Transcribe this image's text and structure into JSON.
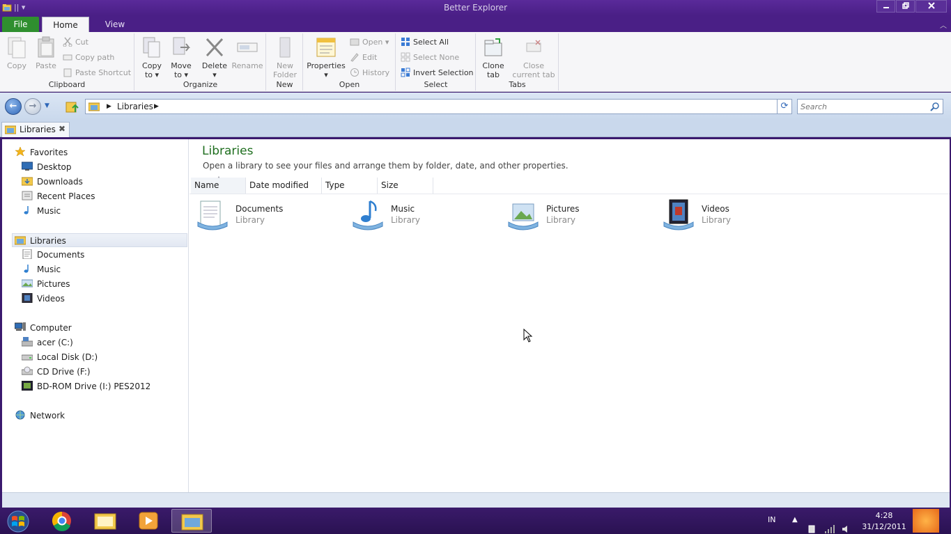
{
  "window": {
    "title": "Better Explorer"
  },
  "ribbon_tabs": {
    "file": "File",
    "home": "Home",
    "view": "View"
  },
  "ribbon": {
    "clipboard": {
      "label": "Clipboard",
      "copy": "Copy",
      "paste": "Paste",
      "cut": "Cut",
      "copy_path": "Copy path",
      "paste_shortcut": "Paste Shortcut"
    },
    "organize": {
      "label": "Organize",
      "copy_to_1": "Copy",
      "copy_to_2": "to ▾",
      "move_to_1": "Move",
      "move_to_2": "to ▾",
      "delete_1": "Delete",
      "delete_2": "▾",
      "rename": "Rename"
    },
    "new": {
      "label": "New",
      "new_folder_1": "New",
      "new_folder_2": "Folder"
    },
    "open": {
      "label": "Open",
      "properties_1": "Properties",
      "properties_2": "▾",
      "open": "Open",
      "edit": "Edit",
      "history": "History"
    },
    "select": {
      "label": "Select",
      "select_all": "Select All",
      "select_none": "Select None",
      "invert_selection": "Invert Selection"
    },
    "tabs": {
      "label": "Tabs",
      "clone_1": "Clone",
      "clone_2": "tab",
      "close_1": "Close",
      "close_2": "current tab"
    }
  },
  "address": {
    "crumb": "Libraries"
  },
  "search": {
    "placeholder": "Search"
  },
  "tab": {
    "label": "Libraries"
  },
  "nav": {
    "favorites": "Favorites",
    "desktop": "Desktop",
    "downloads": "Downloads",
    "recent_places": "Recent Places",
    "music_fav": "Music",
    "libraries": "Libraries",
    "documents": "Documents",
    "music": "Music",
    "pictures": "Pictures",
    "videos": "Videos",
    "computer": "Computer",
    "drive_c": "acer (C:)",
    "drive_d": "Local Disk (D:)",
    "drive_f": "CD Drive (F:)",
    "drive_i": "BD-ROM Drive (I:) PES2012",
    "network": "Network"
  },
  "main": {
    "title": "Libraries",
    "subtitle": "Open a library to see your files and arrange them by folder, date, and other properties.",
    "columns": {
      "name": "Name",
      "date_modified": "Date modified",
      "type": "Type",
      "size": "Size"
    },
    "libraries": [
      {
        "name": "Documents",
        "type": "Library"
      },
      {
        "name": "Music",
        "type": "Library"
      },
      {
        "name": "Pictures",
        "type": "Library"
      },
      {
        "name": "Videos",
        "type": "Library"
      }
    ]
  },
  "taskbar": {
    "lang": "IN",
    "time": "4:28",
    "date": "31/12/2011"
  }
}
